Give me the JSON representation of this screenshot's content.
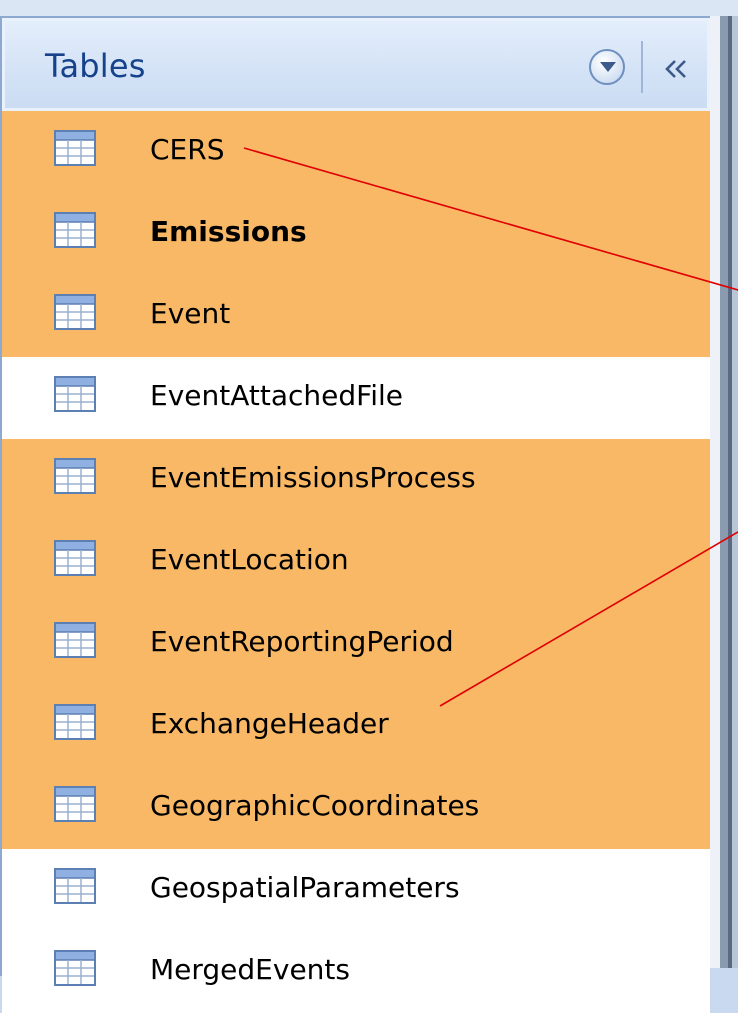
{
  "pane": {
    "title": "Tables",
    "collapse_glyph": "«"
  },
  "tables": [
    {
      "name": "CERS",
      "highlighted": true,
      "bold": false
    },
    {
      "name": "Emissions",
      "highlighted": true,
      "bold": true
    },
    {
      "name": "Event",
      "highlighted": true,
      "bold": false
    },
    {
      "name": "EventAttachedFile",
      "highlighted": false,
      "bold": false
    },
    {
      "name": "EventEmissionsProcess",
      "highlighted": true,
      "bold": false
    },
    {
      "name": "EventLocation",
      "highlighted": true,
      "bold": false
    },
    {
      "name": "EventReportingPeriod",
      "highlighted": true,
      "bold": false
    },
    {
      "name": "ExchangeHeader",
      "highlighted": true,
      "bold": false
    },
    {
      "name": "GeographicCoordinates",
      "highlighted": true,
      "bold": false
    },
    {
      "name": "GeospatialParameters",
      "highlighted": false,
      "bold": false
    },
    {
      "name": "MergedEvents",
      "highlighted": false,
      "bold": false
    }
  ],
  "icons": {
    "row_icon": "table-icon",
    "dropdown": "chevron-down-icon",
    "collapse": "double-chevron-left-icon"
  },
  "colors": {
    "highlight": "#f8b866",
    "header_text": "#15428b",
    "annotation_line": "#e00000"
  }
}
